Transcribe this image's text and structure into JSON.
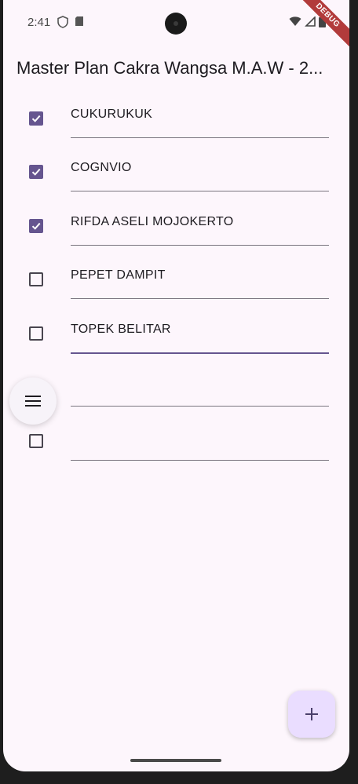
{
  "status_bar": {
    "time": "2:41",
    "icons": [
      "shield-icon",
      "sd-card-icon",
      "wifi-icon",
      "signal-icon",
      "battery-icon"
    ],
    "debug_banner": "DEBUG"
  },
  "app_bar": {
    "title": "Master Plan Cakra Wangsa M.A.W - 2..."
  },
  "tasks": [
    {
      "text": "CUKURUKUK",
      "checked": true
    },
    {
      "text": "COGNVIO",
      "checked": true
    },
    {
      "text": "RIFDA ASELI MOJOKERTO",
      "checked": true
    },
    {
      "text": "PEPET DAMPIT",
      "checked": false
    },
    {
      "text": "TOPEK BELITAR",
      "checked": false,
      "focused": true
    },
    {
      "text": "",
      "checked": false
    },
    {
      "text": "",
      "checked": false
    }
  ],
  "colors": {
    "background": "#fdf6fc",
    "accent": "#65558f",
    "fab_background": "#eaddff"
  },
  "fab": {
    "menu_icon": "menu-icon",
    "add_icon": "plus-icon"
  }
}
